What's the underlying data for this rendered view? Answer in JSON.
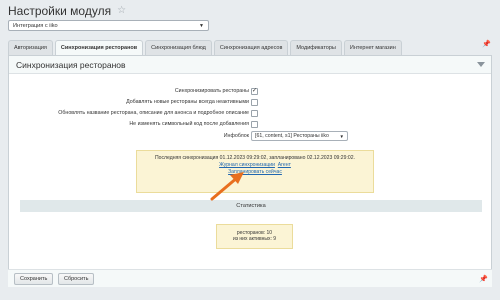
{
  "page": {
    "title": "Настройки модуля"
  },
  "module_select": {
    "value": "Интеграция с iiko"
  },
  "tabs": [
    {
      "label": "Авторизация"
    },
    {
      "label": "Синхронизация ресторанов"
    },
    {
      "label": "Синхронизация блюд"
    },
    {
      "label": "Синхронизация адресов"
    },
    {
      "label": "Модификаторы"
    },
    {
      "label": "Интернет магазин"
    }
  ],
  "panel": {
    "title": "Синхронизация ресторанов"
  },
  "form": {
    "rows": [
      {
        "label": "Синхронизировать рестораны",
        "checked": true
      },
      {
        "label": "Добавлять новые рестораны всегда неактивными",
        "checked": false
      },
      {
        "label": "Обновлять название ресторана, описание для анонса и подробное описание",
        "checked": false
      },
      {
        "label": "Не изменять символьный код после добавления",
        "checked": false
      }
    ],
    "check_mark": "✓",
    "infoblock_label": "Инфоблок",
    "infoblock_value": "[61, content, s1] Рестораны iiko"
  },
  "sync": {
    "status": "Последняя синхронизация 01.12.2023 09:29:02, запланировано 02.12.2023 09:29:02.",
    "journal_link": "Журнал синхронизации",
    "agent_link": "Агент",
    "schedule_now_link": "Запланировать сейчас"
  },
  "stats": {
    "title": "Статистика",
    "restaurants": "ресторанов: 10",
    "active": "из них активных: 9"
  },
  "footer": {
    "save_label": "Сохранить",
    "reset_label": "Сбросить"
  },
  "colors": {
    "accent_arrow": "#e86f1f",
    "link": "#2067b0",
    "notice_bg": "#fbf4d5"
  }
}
